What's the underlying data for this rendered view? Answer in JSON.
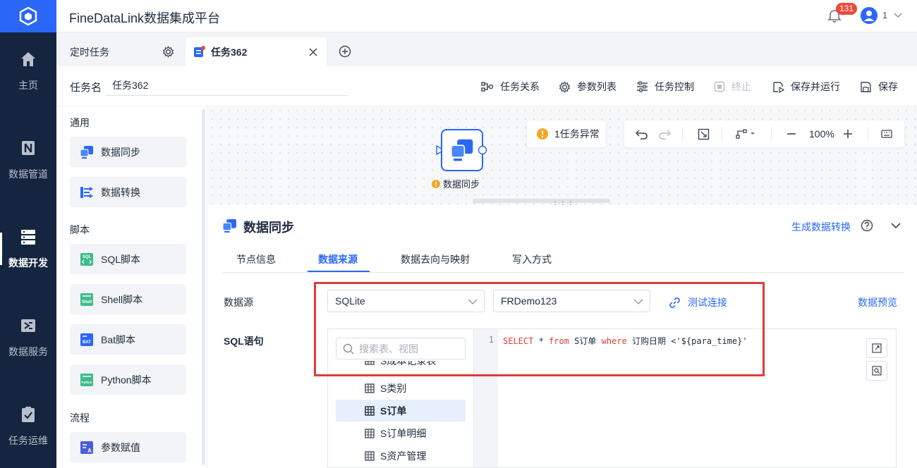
{
  "app": {
    "title": "FineDataLink数据集成平台"
  },
  "topbar": {
    "notifications": "131",
    "user": "1"
  },
  "sidebar": {
    "items": [
      {
        "label": "主页",
        "icon": "home-icon"
      },
      {
        "label": "数据管道",
        "icon": "pipeline-icon"
      },
      {
        "label": "数据开发",
        "icon": "server-icon",
        "active": true
      },
      {
        "label": "数据服务",
        "icon": "service-icon"
      },
      {
        "label": "任务运维",
        "icon": "clipboard-check-icon"
      }
    ]
  },
  "tabs": [
    {
      "label": "定时任务",
      "icon": "gear-icon"
    },
    {
      "label": "任务362",
      "icon": "task-file-icon",
      "active": true
    }
  ],
  "taskbar": {
    "name_label": "任务名",
    "name_value": "任务362",
    "actions": [
      "任务关系",
      "参数列表",
      "任务控制",
      "终止",
      "保存并运行",
      "保存"
    ]
  },
  "palette": {
    "sections": [
      "通用",
      "脚本",
      "流程"
    ],
    "items": [
      "数据同步",
      "数据转换",
      "SQL脚本",
      "Shell脚本",
      "Bat脚本",
      "Python脚本",
      "参数赋值"
    ]
  },
  "canvas": {
    "alert": "1任务异常",
    "zoom": "100%",
    "node_label": "数据同步"
  },
  "detail": {
    "title": "数据同步",
    "generate_link": "生成数据转换",
    "subtabs": [
      "节点信息",
      "数据来源",
      "数据去向与映射",
      "写入方式"
    ],
    "datasource_label": "数据源",
    "db_type": "SQLite",
    "connection": "FRDemo123",
    "test_connection": "测试连接",
    "preview": "数据预览",
    "sql_label": "SQL语句",
    "search_placeholder": "搜索表、视图",
    "tables": [
      "S成本记录表",
      "S类别",
      "S订单",
      "S订单明细",
      "S资产管理"
    ],
    "selected_table": "S订单",
    "line_no": "1",
    "sql": {
      "k1": "SELECT",
      "t1": " * ",
      "k2": "from",
      "t2": " S订单 ",
      "k3": "where",
      "t3": " 订购日期 <'${para_time}'"
    }
  },
  "colors": {
    "accent": "#2a67f7",
    "sidebar": "#15243f",
    "highlight": "#e23a3a",
    "keyword": "#e0403a"
  }
}
